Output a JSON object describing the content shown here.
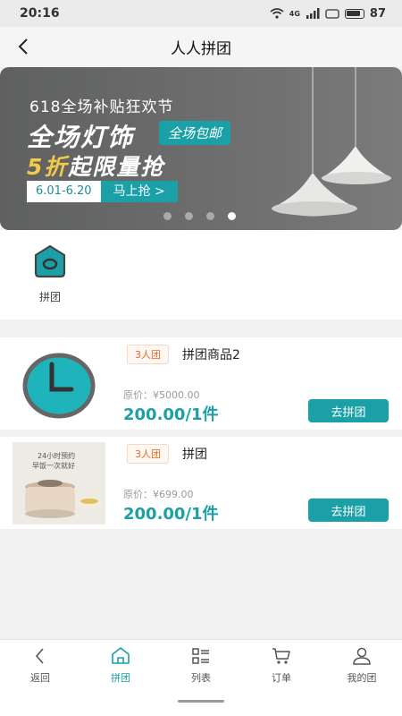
{
  "status": {
    "time": "20:16",
    "battery": "87",
    "network": "4G"
  },
  "nav": {
    "title": "人人拼团"
  },
  "banner": {
    "subtitle": "618全场补贴狂欢节",
    "headline1": "全场灯饰",
    "tag": "全场包邮",
    "headline2a": "5折",
    "headline2b": "起限量抢",
    "date": "6.01-6.20",
    "cta": "马上抢 >",
    "slide_count": 4,
    "active_slide": 4
  },
  "categories": [
    {
      "label": "拼团",
      "icon": "house-icon"
    }
  ],
  "products": [
    {
      "badge": "3人团",
      "name": "拼团商品2",
      "original_price": "原价：¥5000.00",
      "price": "200.00/1件",
      "button": "去拼团",
      "image": "clock-icon"
    },
    {
      "badge": "3人团",
      "name": "拼团",
      "original_price": "原价：¥699.00",
      "price": "200.00/1件",
      "button": "去拼团",
      "image": "cooker-image",
      "image_text1": "24小时预约",
      "image_text2": "早饭一次就好"
    }
  ],
  "tabs": [
    {
      "label": "返回",
      "icon": "back-icon"
    },
    {
      "label": "拼团",
      "icon": "home-icon",
      "active": true
    },
    {
      "label": "列表",
      "icon": "list-icon"
    },
    {
      "label": "订单",
      "icon": "cart-icon"
    },
    {
      "label": "我的团",
      "icon": "user-icon"
    }
  ],
  "colors": {
    "accent": "#1aa0a6",
    "badge": "#e46b2a",
    "banner_bg": "#666666"
  }
}
